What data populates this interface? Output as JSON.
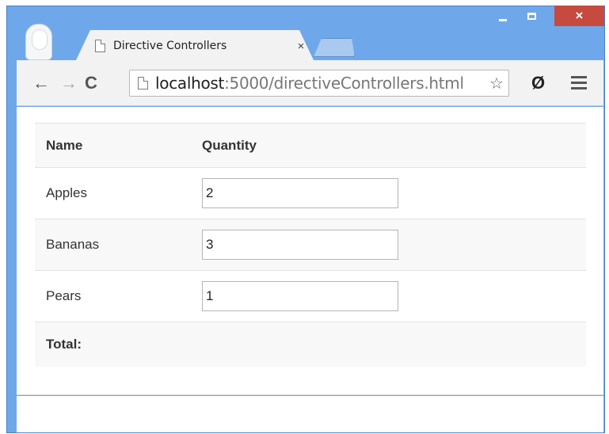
{
  "browser": {
    "tab_title": "Directive Controllers",
    "tab_close": "×",
    "url_host": "localhost",
    "url_path": ":5000/directiveControllers.html",
    "window_close": "×",
    "nav_back": "←",
    "nav_forward": "→",
    "nav_reload": "C",
    "star": "☆",
    "extension": "Ø"
  },
  "table": {
    "headers": {
      "name": "Name",
      "quantity": "Quantity"
    },
    "rows": [
      {
        "name": "Apples",
        "quantity": "2"
      },
      {
        "name": "Bananas",
        "quantity": "3"
      },
      {
        "name": "Pears",
        "quantity": "1"
      }
    ],
    "footer_label": "Total:"
  }
}
